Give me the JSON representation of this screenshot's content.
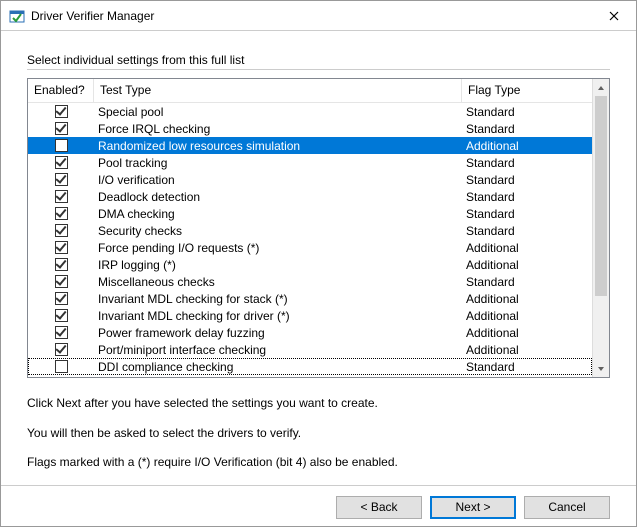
{
  "window": {
    "title": "Driver Verifier Manager"
  },
  "group_label": "Select individual settings from this full list",
  "columns": {
    "enabled": "Enabled?",
    "test_type": "Test Type",
    "flag_type": "Flag Type"
  },
  "rows": [
    {
      "checked": true,
      "test_type": "Special pool",
      "flag_type": "Standard",
      "selected": false,
      "focused": false
    },
    {
      "checked": true,
      "test_type": "Force IRQL checking",
      "flag_type": "Standard",
      "selected": false,
      "focused": false
    },
    {
      "checked": false,
      "test_type": "Randomized low resources simulation",
      "flag_type": "Additional",
      "selected": true,
      "focused": false
    },
    {
      "checked": true,
      "test_type": "Pool tracking",
      "flag_type": "Standard",
      "selected": false,
      "focused": false
    },
    {
      "checked": true,
      "test_type": "I/O verification",
      "flag_type": "Standard",
      "selected": false,
      "focused": false
    },
    {
      "checked": true,
      "test_type": "Deadlock detection",
      "flag_type": "Standard",
      "selected": false,
      "focused": false
    },
    {
      "checked": true,
      "test_type": "DMA checking",
      "flag_type": "Standard",
      "selected": false,
      "focused": false
    },
    {
      "checked": true,
      "test_type": "Security checks",
      "flag_type": "Standard",
      "selected": false,
      "focused": false
    },
    {
      "checked": true,
      "test_type": "Force pending I/O requests (*)",
      "flag_type": "Additional",
      "selected": false,
      "focused": false
    },
    {
      "checked": true,
      "test_type": "IRP logging (*)",
      "flag_type": "Additional",
      "selected": false,
      "focused": false
    },
    {
      "checked": true,
      "test_type": "Miscellaneous checks",
      "flag_type": "Standard",
      "selected": false,
      "focused": false
    },
    {
      "checked": true,
      "test_type": "Invariant MDL checking for stack (*)",
      "flag_type": "Additional",
      "selected": false,
      "focused": false
    },
    {
      "checked": true,
      "test_type": "Invariant MDL checking for driver (*)",
      "flag_type": "Additional",
      "selected": false,
      "focused": false
    },
    {
      "checked": true,
      "test_type": "Power framework delay fuzzing",
      "flag_type": "Additional",
      "selected": false,
      "focused": false
    },
    {
      "checked": true,
      "test_type": "Port/miniport interface checking",
      "flag_type": "Additional",
      "selected": false,
      "focused": false
    },
    {
      "checked": false,
      "test_type": "DDI compliance checking",
      "flag_type": "Standard",
      "selected": false,
      "focused": true
    }
  ],
  "info": {
    "line1": "Click Next after you have selected the settings you want to create.",
    "line2": "You will then be asked to select the drivers to verify.",
    "line3": "Flags marked with a (*) require I/O Verification (bit 4) also be enabled."
  },
  "buttons": {
    "back": "< Back",
    "next": "Next >",
    "cancel": "Cancel"
  }
}
